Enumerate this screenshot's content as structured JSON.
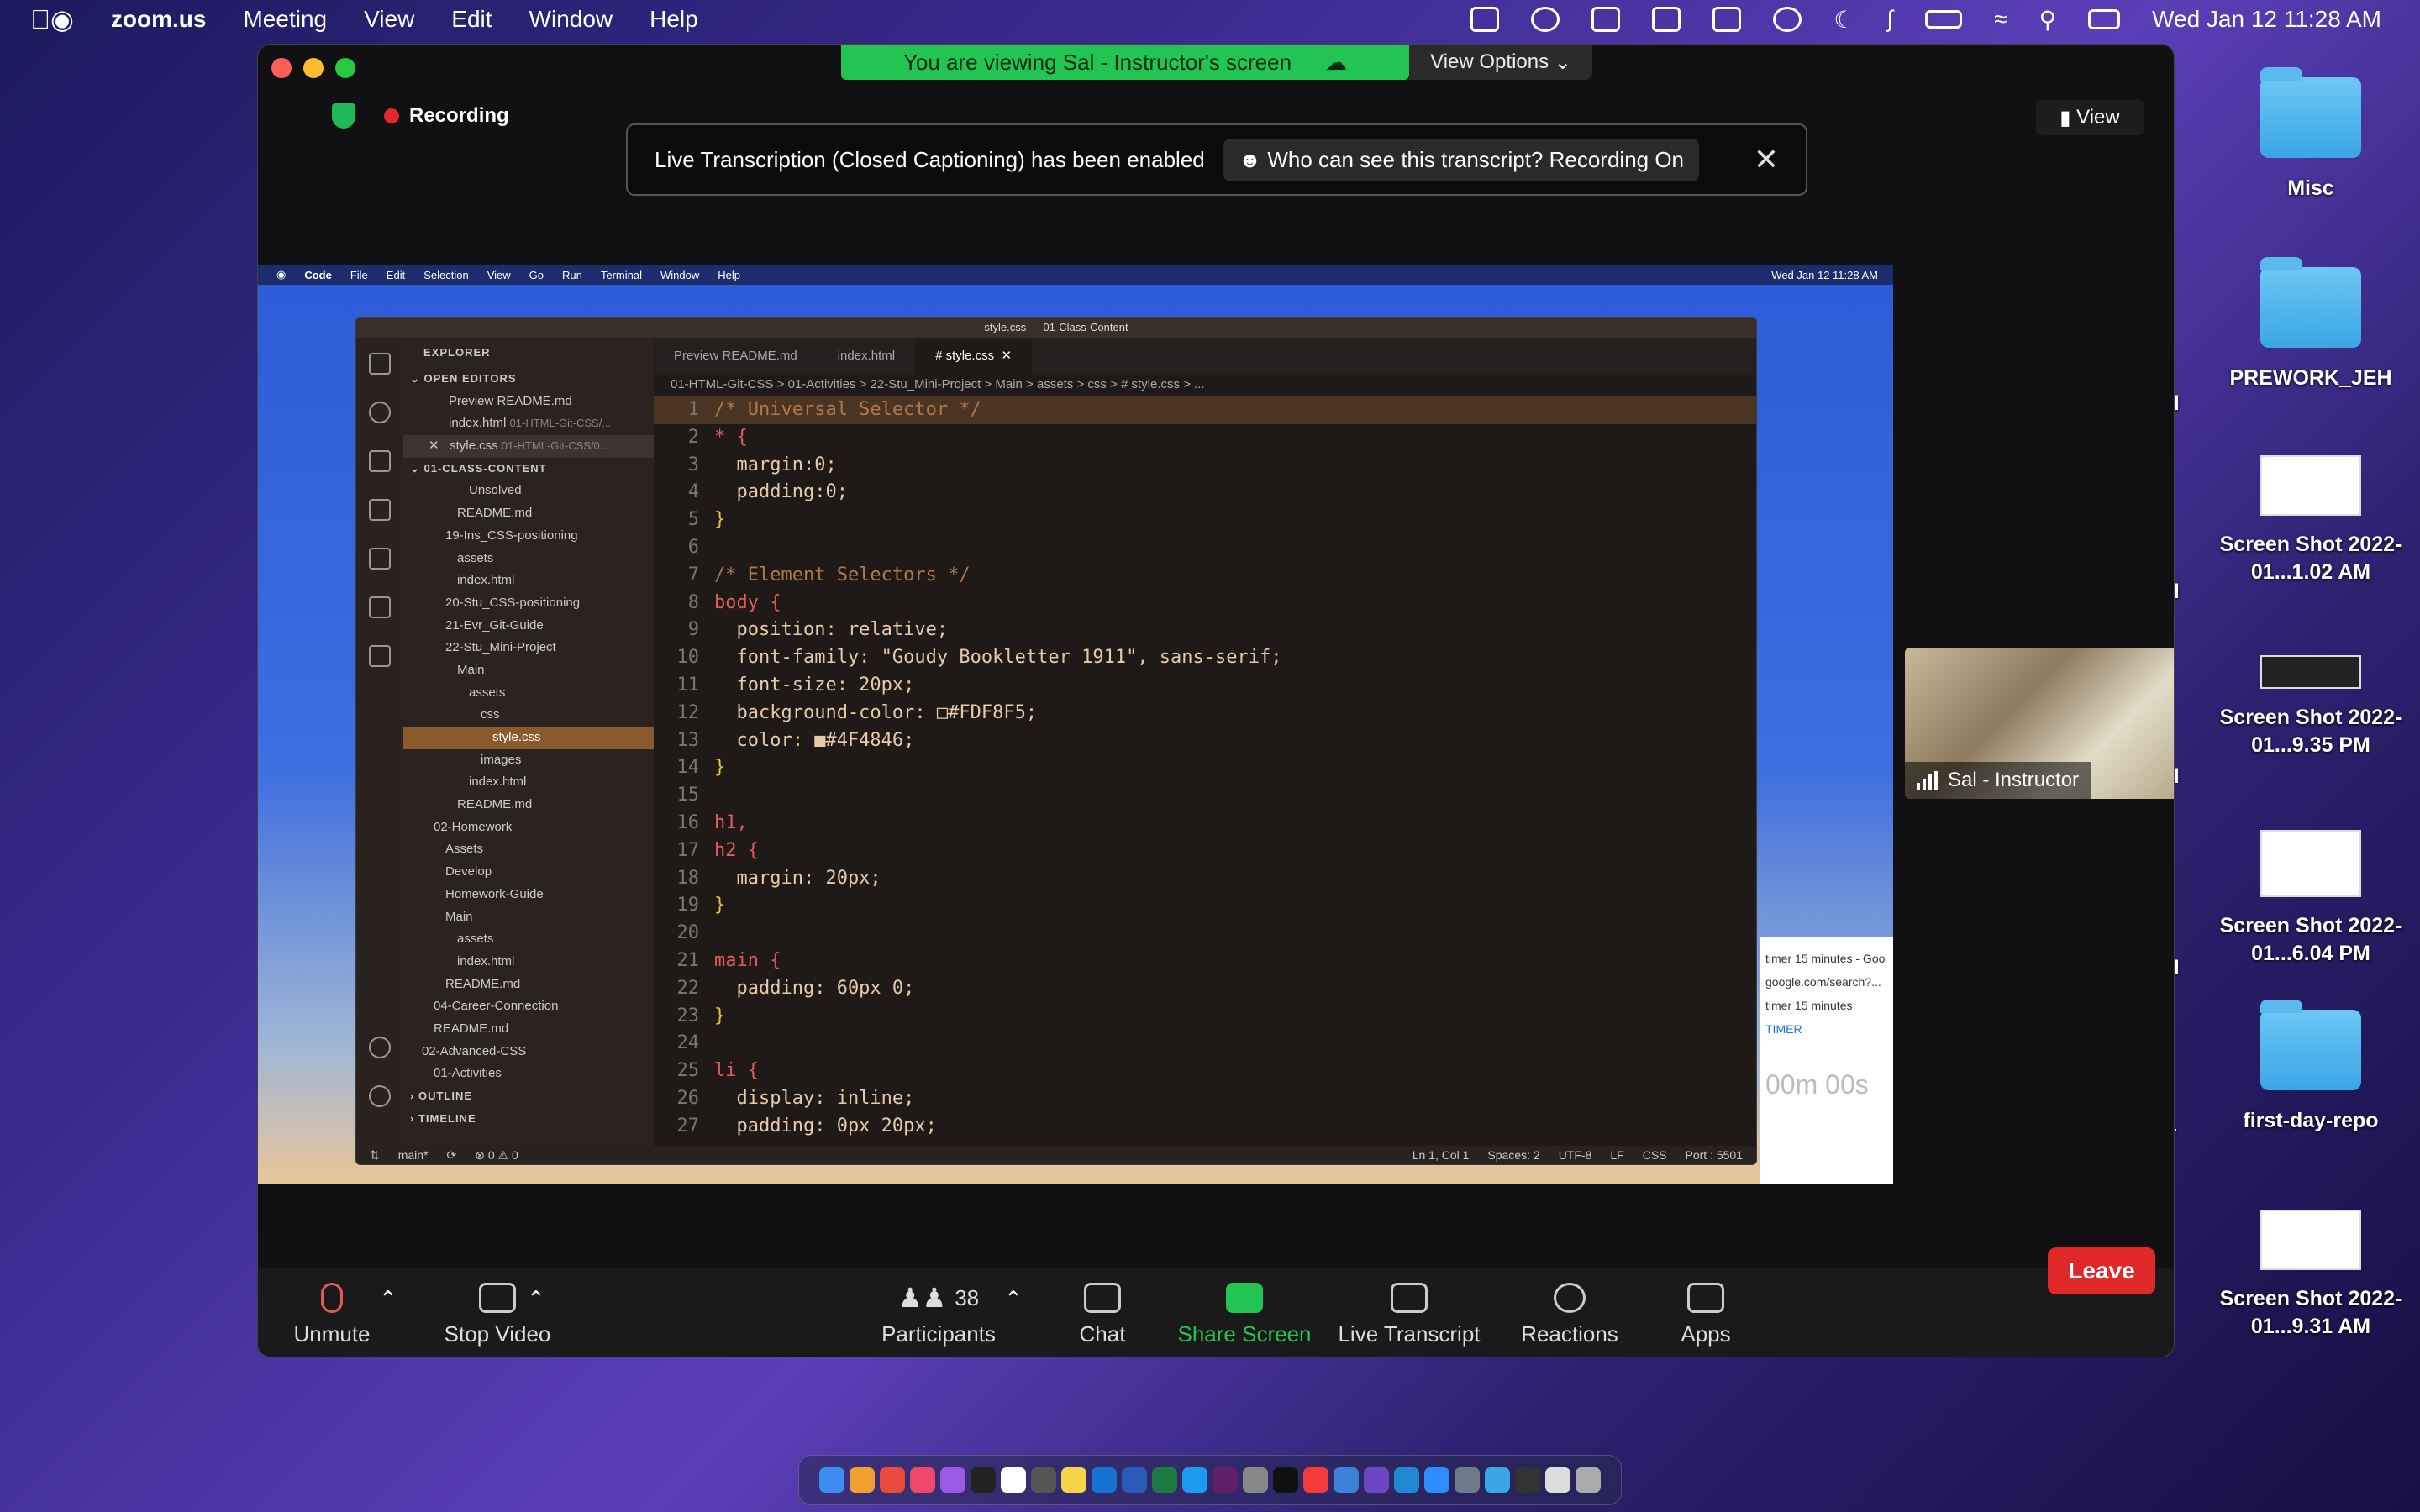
{
  "menubar": {
    "app": "zoom.us",
    "items": [
      "Meeting",
      "View",
      "Edit",
      "Window",
      "Help"
    ],
    "clock": "Wed Jan 12  11:28 AM"
  },
  "desktop": {
    "items": [
      {
        "label": "Misc",
        "kind": "folder"
      },
      {
        "label": "PREWORK_JEH",
        "kind": "folder"
      },
      {
        "label": "Screen Shot 2022-01...1.02 AM",
        "kind": "screenshot"
      },
      {
        "label": "Screen Shot 2022-01...9.35 PM",
        "kind": "screenshot"
      },
      {
        "label": "Screen Shot 2022-01...6.04 PM",
        "kind": "screenshot"
      },
      {
        "label": "first-day-repo",
        "kind": "folder"
      },
      {
        "label": "Screen Shot 2022-01...9.31 AM",
        "kind": "screenshot"
      }
    ],
    "cut_labels": [
      "PM",
      "PM",
      "PM",
      "PM",
      "er-"
    ]
  },
  "zoom": {
    "banner": "You are viewing Sal - Instructor's screen",
    "view_options": "View Options",
    "recording": "Recording",
    "view_button": "View",
    "transcription": {
      "message": "Live Transcription (Closed Captioning) has been enabled",
      "pill": "Who can see this transcript? Recording On"
    },
    "participant": "Sal - Instructor",
    "controls": {
      "unmute": "Unmute",
      "stop_video": "Stop Video",
      "participants": "Participants",
      "participant_count": "38",
      "chat": "Chat",
      "share_screen": "Share Screen",
      "live_transcript": "Live Transcript",
      "reactions": "Reactions",
      "apps": "Apps",
      "leave": "Leave"
    }
  },
  "shared": {
    "menubar": [
      "Code",
      "File",
      "Edit",
      "Selection",
      "View",
      "Go",
      "Run",
      "Terminal",
      "Window",
      "Help"
    ],
    "clock": "Wed Jan 12  11:28 AM",
    "vscode": {
      "title": "style.css — 01-Class-Content",
      "explorer": "EXPLORER",
      "open_editors": "OPEN EDITORS",
      "open_files": [
        {
          "name": "Preview README.md",
          "path": ""
        },
        {
          "name": "index.html",
          "path": "01-HTML-Git-CSS/..."
        },
        {
          "name": "style.css",
          "path": "01-HTML-Git-CSS/0..."
        }
      ],
      "folder": "01-CLASS-CONTENT",
      "tree": [
        {
          "label": "Unsolved",
          "indent": 3
        },
        {
          "label": "README.md",
          "indent": 2
        },
        {
          "label": "19-Ins_CSS-positioning",
          "indent": 1
        },
        {
          "label": "assets",
          "indent": 2
        },
        {
          "label": "index.html",
          "indent": 2
        },
        {
          "label": "20-Stu_CSS-positioning",
          "indent": 1
        },
        {
          "label": "21-Evr_Git-Guide",
          "indent": 1
        },
        {
          "label": "22-Stu_Mini-Project",
          "indent": 1
        },
        {
          "label": "Main",
          "indent": 2
        },
        {
          "label": "assets",
          "indent": 3
        },
        {
          "label": "css",
          "indent": 4
        },
        {
          "label": "style.css",
          "indent": 5
        },
        {
          "label": "images",
          "indent": 4
        },
        {
          "label": "index.html",
          "indent": 3
        },
        {
          "label": "README.md",
          "indent": 2
        },
        {
          "label": "02-Homework",
          "indent": 0
        },
        {
          "label": "Assets",
          "indent": 1
        },
        {
          "label": "Develop",
          "indent": 1
        },
        {
          "label": "Homework-Guide",
          "indent": 1
        },
        {
          "label": "Main",
          "indent": 1
        },
        {
          "label": "assets",
          "indent": 2
        },
        {
          "label": "index.html",
          "indent": 2
        },
        {
          "label": "README.md",
          "indent": 1
        },
        {
          "label": "04-Career-Connection",
          "indent": 0
        },
        {
          "label": "README.md",
          "indent": 0
        },
        {
          "label": "02-Advanced-CSS",
          "indent": -1
        },
        {
          "label": "01-Activities",
          "indent": 0
        }
      ],
      "outline": "OUTLINE",
      "timeline": "TIMELINE",
      "tabs": [
        "Preview README.md",
        "index.html",
        "style.css"
      ],
      "breadcrumb": "01-HTML-Git-CSS > 01-Activities > 22-Stu_Mini-Project > Main > assets > css > # style.css > ...",
      "code": [
        {
          "n": "1",
          "t": "/* Universal Selector */",
          "c": "cm"
        },
        {
          "n": "2",
          "t": "* {",
          "c": "sel2"
        },
        {
          "n": "3",
          "t": "  margin:0;",
          "c": "pr"
        },
        {
          "n": "4",
          "t": "  padding:0;",
          "c": "pr"
        },
        {
          "n": "5",
          "t": "}",
          "c": "br"
        },
        {
          "n": "6",
          "t": "",
          "c": "pr"
        },
        {
          "n": "7",
          "t": "/* Element Selectors */",
          "c": "cm"
        },
        {
          "n": "8",
          "t": "body {",
          "c": "sel2"
        },
        {
          "n": "9",
          "t": "  position: relative;",
          "c": "pr"
        },
        {
          "n": "10",
          "t": "  font-family: \"Goudy Bookletter 1911\", sans-serif;",
          "c": "pr"
        },
        {
          "n": "11",
          "t": "  font-size: 20px;",
          "c": "pr"
        },
        {
          "n": "12",
          "t": "  background-color: □#FDF8F5;",
          "c": "pr"
        },
        {
          "n": "13",
          "t": "  color: ■#4F4846;",
          "c": "pr"
        },
        {
          "n": "14",
          "t": "}",
          "c": "br"
        },
        {
          "n": "15",
          "t": "",
          "c": "pr"
        },
        {
          "n": "16",
          "t": "h1,",
          "c": "sel2"
        },
        {
          "n": "17",
          "t": "h2 {",
          "c": "sel2"
        },
        {
          "n": "18",
          "t": "  margin: 20px;",
          "c": "pr"
        },
        {
          "n": "19",
          "t": "}",
          "c": "br"
        },
        {
          "n": "20",
          "t": "",
          "c": "pr"
        },
        {
          "n": "21",
          "t": "main {",
          "c": "sel2"
        },
        {
          "n": "22",
          "t": "  padding: 60px 0;",
          "c": "pr"
        },
        {
          "n": "23",
          "t": "}",
          "c": "br"
        },
        {
          "n": "24",
          "t": "",
          "c": "pr"
        },
        {
          "n": "25",
          "t": "li {",
          "c": "sel2"
        },
        {
          "n": "26",
          "t": "  display: inline;",
          "c": "pr"
        },
        {
          "n": "27",
          "t": "  padding: 0px 20px;",
          "c": "pr"
        }
      ],
      "status_left": [
        "main*",
        "⟳",
        "⊗ 0 ⚠ 0"
      ],
      "status_right": [
        "Ln 1, Col 1",
        "Spaces: 2",
        "UTF-8",
        "LF",
        "CSS",
        "Port : 5501"
      ]
    },
    "chrome": {
      "tab": "timer 15 minutes - Goo",
      "url": "google.com/search?...",
      "query": "timer 15 minutes",
      "timer_label": "TIMER",
      "display": "00m 00s"
    }
  }
}
